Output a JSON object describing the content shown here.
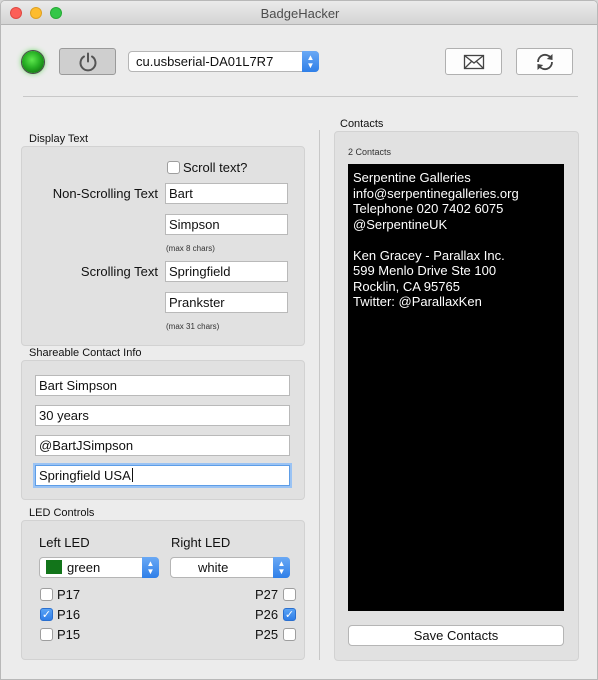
{
  "window": {
    "title": "BadgeHacker"
  },
  "toolbar": {
    "port": "cu.usbserial-DA01L7R7",
    "icons": {
      "led": "status-led-icon",
      "power": "power-icon",
      "mail": "envelope-icon",
      "refresh": "refresh-icon"
    }
  },
  "display_text": {
    "label": "Display Text",
    "scroll_label": "Scroll text?",
    "scroll_checked": false,
    "non_scrolling_label": "Non-Scrolling Text",
    "non_scrolling": [
      "Bart",
      "Simpson"
    ],
    "non_scrolling_hint": "(max 8 chars)",
    "scrolling_label": "Scrolling Text",
    "scrolling": [
      "Springfield",
      "Prankster"
    ],
    "scrolling_hint": "(max 31 chars)"
  },
  "contact_info": {
    "label": "Shareable Contact Info",
    "fields": [
      "Bart Simpson",
      "30 years",
      "@BartJSimpson",
      "Springfield USA"
    ]
  },
  "led_controls": {
    "label": "LED Controls",
    "left_label": "Left LED",
    "left_value": "green",
    "left_color": "#12751a",
    "right_label": "Right LED",
    "right_value": "white",
    "left_pins": [
      {
        "label": "P17",
        "checked": false
      },
      {
        "label": "P16",
        "checked": true
      },
      {
        "label": "P15",
        "checked": false
      }
    ],
    "right_pins": [
      {
        "label": "P27",
        "checked": false
      },
      {
        "label": "P26",
        "checked": true
      },
      {
        "label": "P25",
        "checked": false
      }
    ]
  },
  "contacts": {
    "label": "Contacts",
    "count": "2 Contacts",
    "lines": [
      "Serpentine Galleries",
      "info@serpentinegalleries.org",
      "Telephone 020 7402 6075",
      "@SerpentineUK",
      "",
      "Ken Gracey - Parallax Inc.",
      "599 Menlo Drive Ste 100",
      "Rocklin, CA 95765",
      "Twitter: @ParallaxKen"
    ],
    "save_label": "Save Contacts"
  }
}
